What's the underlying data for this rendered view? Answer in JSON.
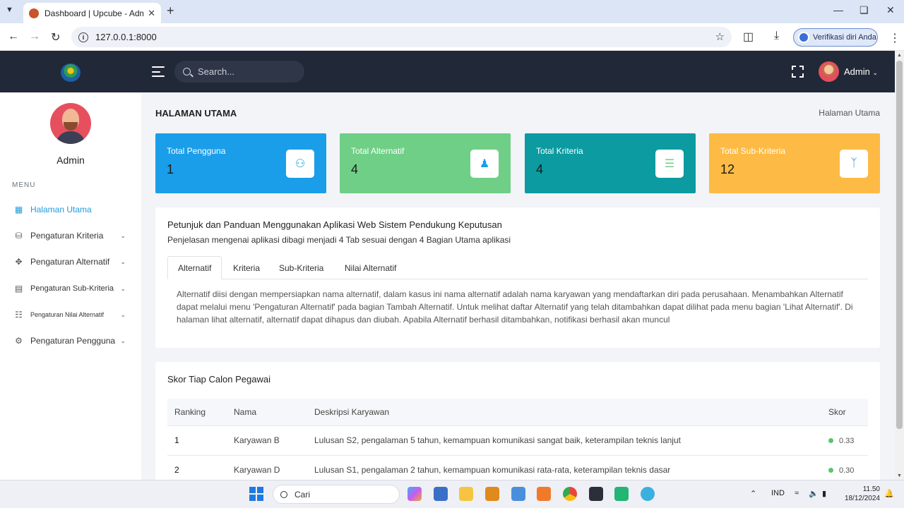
{
  "browser": {
    "tab_title": "Dashboard | Upcube - Admin &",
    "url": "127.0.0.1:8000",
    "verify_label": "Verifikasi diri Anda"
  },
  "header": {
    "search_placeholder": "Search...",
    "user": "Admin"
  },
  "sidebar": {
    "user_name": "Admin",
    "menu_header": "MENU",
    "items": [
      {
        "label": "Halaman Utama",
        "icon": "dashboard-icon",
        "active": true
      },
      {
        "label": "Pengaturan Kriteria",
        "icon": "database-icon"
      },
      {
        "label": "Pengaturan Alternatif",
        "icon": "move-icon"
      },
      {
        "label": "Pengaturan Sub-Kriteria",
        "icon": "document-icon"
      },
      {
        "label": "Pengaturan Nilai Alternatif",
        "icon": "clipboard-icon"
      },
      {
        "label": "Pengaturan Pengguna",
        "icon": "user-cog-icon"
      }
    ]
  },
  "page": {
    "title": "HALAMAN UTAMA",
    "breadcrumb": "Halaman Utama"
  },
  "stats": [
    {
      "label": "Total Pengguna",
      "value": "1",
      "color": "#1a9ee9",
      "icon": "users-icon"
    },
    {
      "label": "Total Alternatif",
      "value": "4",
      "color": "#6fcf86",
      "icon": "user-tie-icon"
    },
    {
      "label": "Total Kriteria",
      "value": "4",
      "color": "#0b9ba1",
      "icon": "list-icon"
    },
    {
      "label": "Total Sub-Kriteria",
      "value": "12",
      "color": "#fdbb45",
      "icon": "branch-icon"
    }
  ],
  "guide": {
    "title": "Petunjuk dan Panduan Menggunakan Aplikasi Web Sistem Pendukung Keputusan",
    "subtitle": "Penjelasan mengenai aplikasi dibagi menjadi 4 Tab sesuai dengan 4 Bagian Utama aplikasi",
    "tabs": [
      "Alternatif",
      "Kriteria",
      "Sub-Kriteria",
      "Nilai Alternatif"
    ],
    "active_tab": "Alternatif",
    "content": "Alternatif diisi dengan mempersiapkan nama alternatif, dalam kasus ini nama alternatif adalah nama karyawan yang mendaftarkan diri pada perusahaan. Menambahkan Alternatif dapat melalui menu 'Pengaturan Alternatif' pada bagian Tambah Alternatif. Untuk melihat daftar Alternatif yang telah ditambahkan dapat dilihat pada menu bagian 'Lihat Alternatif'. Di halaman lihat alternatif, alternatif dapat dihapus dan diubah. Apabila Alternatif berhasil ditambahkan, notifikasi berhasil akan muncul"
  },
  "scores": {
    "title": "Skor Tiap Calon Pegawai",
    "columns": [
      "Ranking",
      "Nama",
      "Deskripsi Karyawan",
      "Skor"
    ],
    "rows": [
      {
        "rank": "1",
        "name": "Karyawan B",
        "desc": "Lulusan S2, pengalaman 5 tahun, kemampuan komunikasi sangat baik, keterampilan teknis lanjut",
        "score": "0.33"
      },
      {
        "rank": "2",
        "name": "Karyawan D",
        "desc": "Lulusan S1, pengalaman 2 tahun, kemampuan komunikasi rata-rata, keterampilan teknis dasar",
        "score": "0.30"
      }
    ]
  },
  "taskbar": {
    "search_label": "Cari",
    "lang": "IND",
    "time": "11.50",
    "date": "18/12/2024"
  }
}
